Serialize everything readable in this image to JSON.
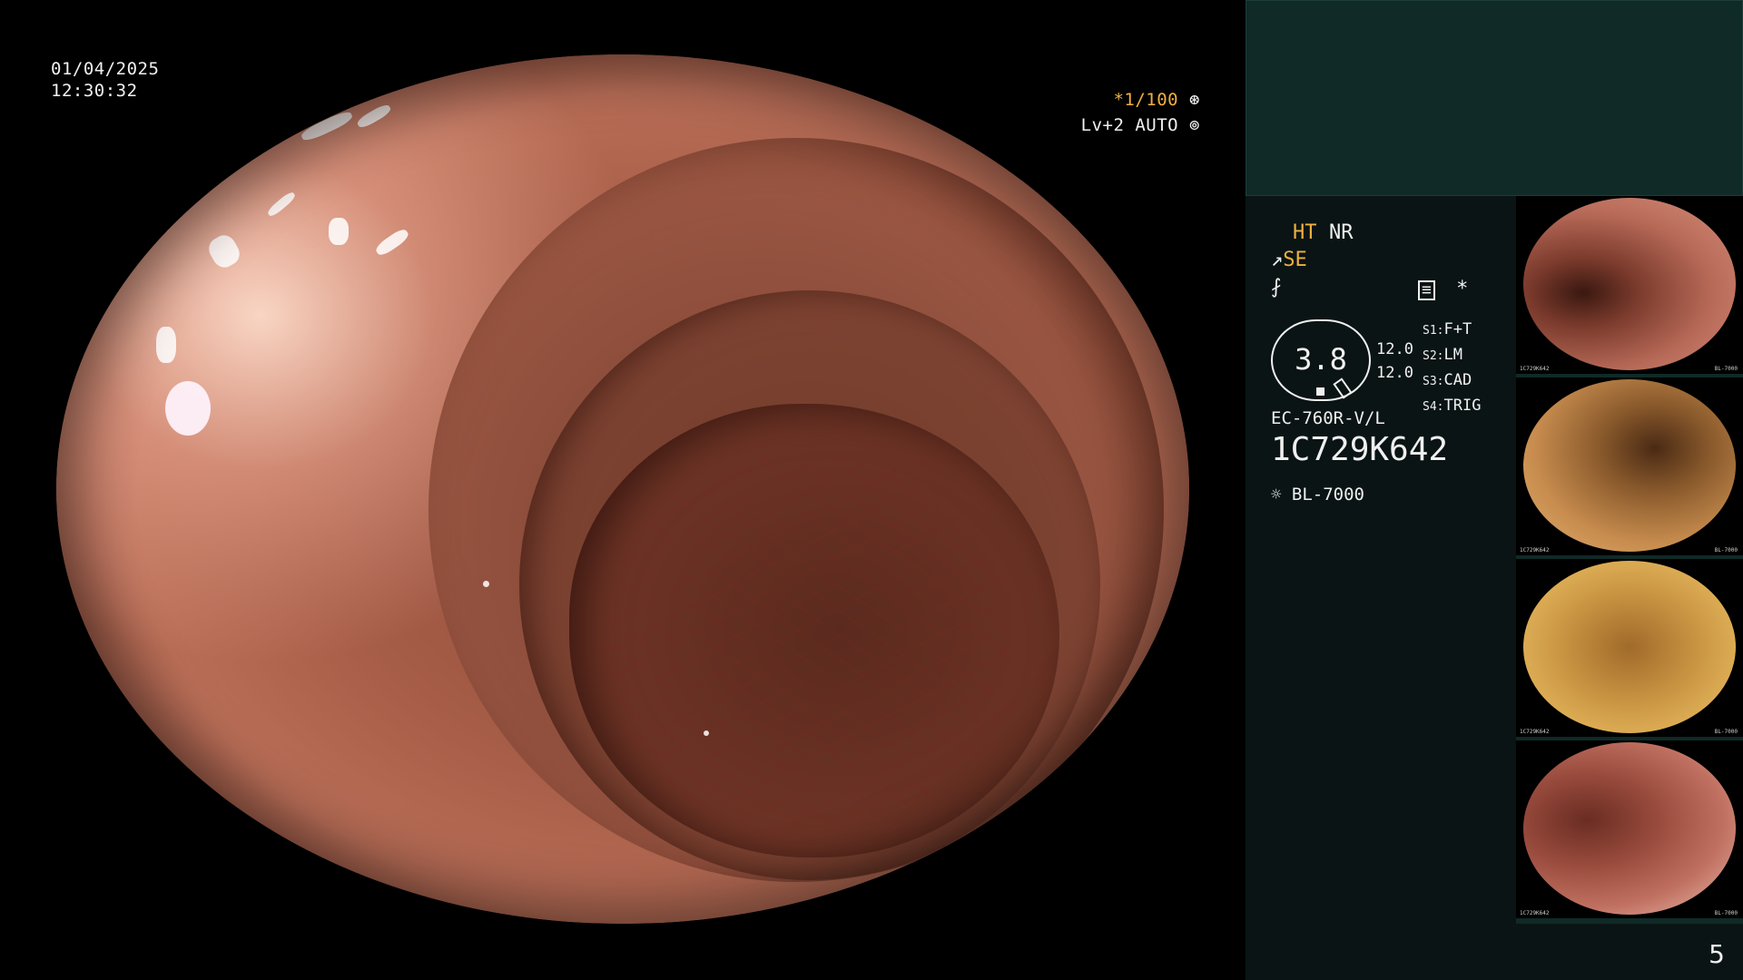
{
  "overlay": {
    "date": "01/04/2025",
    "time": "12:30:32",
    "shutter": "*1/100",
    "iris": "Lv+2 AUTO"
  },
  "panel": {
    "mode1": "HT",
    "mode2": "NR",
    "se": "SE",
    "gauge_value": "3.8",
    "gauge_scale_1": "12.0",
    "gauge_scale_2": "12.0",
    "settings": [
      {
        "key": "S1:",
        "value": "F+T"
      },
      {
        "key": "S2:",
        "value": "LM"
      },
      {
        "key": "S3:",
        "value": "CAD"
      },
      {
        "key": "S4:",
        "value": "TRIG"
      }
    ],
    "scope_model": "EC-760R-V/L",
    "serial": "1C729K642",
    "light_source": "BL-7000",
    "asterisk": "*"
  },
  "thumbnails": [
    {
      "serial": "1C729K642",
      "light": "BL-7000",
      "index": "4",
      "tone": "#b86a58"
    },
    {
      "serial": "1C729K642",
      "light": "BL-7000",
      "index": "3",
      "tone": "#c78c4e"
    },
    {
      "serial": "1C729K642",
      "light": "BL-7000",
      "index": "2",
      "tone": "#c99442"
    },
    {
      "serial": "1C729K642",
      "light": "BL-7000",
      "index": "1",
      "tone": "#c07060"
    }
  ],
  "page_number": "5"
}
